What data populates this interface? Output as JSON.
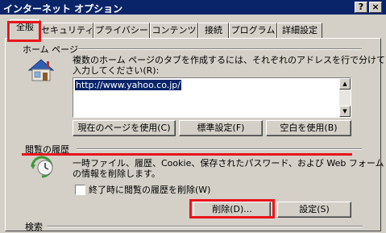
{
  "window": {
    "title": "インターネット オプション",
    "help_button": "?",
    "close_button": "×"
  },
  "tabs": [
    {
      "label": "全般"
    },
    {
      "label": "セキュリティ"
    },
    {
      "label": "プライバシー"
    },
    {
      "label": "コンテンツ"
    },
    {
      "label": "接続"
    },
    {
      "label": "プログラム"
    },
    {
      "label": "詳細設定"
    }
  ],
  "homepage": {
    "section_title": "ホーム ページ",
    "description_line1": "複数のホーム ページのタブを作成するには、それぞれのアドレスを行で分けて",
    "description_line2": "入力してください(R):",
    "url": "http://www.yahoo.co.jp/",
    "buttons": {
      "use_current": "現在のページを使用(C)",
      "use_default": "標準設定(F)",
      "use_blank": "空白を使用(B)"
    }
  },
  "history": {
    "section_title": "閲覧の履歴",
    "description_line1": "一時ファイル、履歴、Cookie、保存されたパスワード、および Web フォーム",
    "description_line2": "の情報を削除します。",
    "checkbox_label": "終了時に閲覧の履歴を削除(W)",
    "buttons": {
      "delete": "削除(D)...",
      "settings": "設定(S)"
    }
  },
  "search": {
    "section_title": "検索"
  },
  "highlight_color": "#e8141c"
}
